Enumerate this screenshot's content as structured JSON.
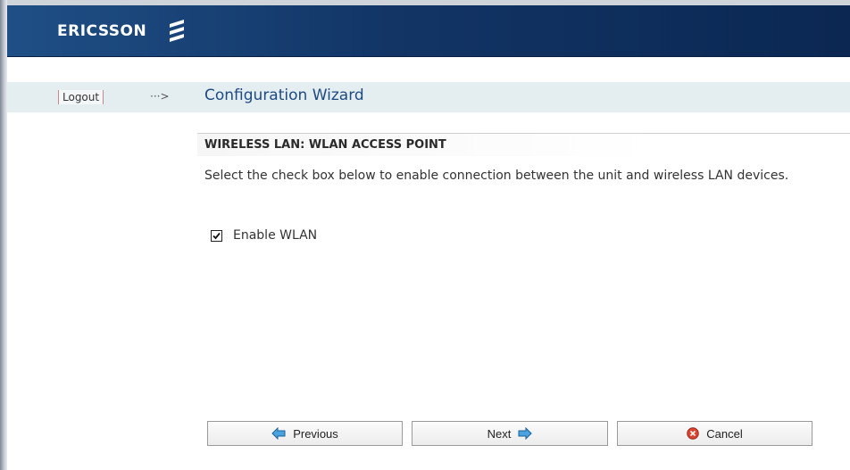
{
  "header": {
    "logo_text": "ERICSSON",
    "logo_icon": "ericsson-logo-icon",
    "background_color": "#123566"
  },
  "nav": {
    "logout_label": "Logout",
    "arrow_text": "···>",
    "title": "Configuration Wizard"
  },
  "section": {
    "title": "WIRELESS LAN: WLAN ACCESS POINT",
    "description": "Select the check box below to enable connection between the unit and wireless LAN devices."
  },
  "form": {
    "enable_wlan_label": "Enable WLAN",
    "enable_wlan_checked": true
  },
  "buttons": {
    "previous_label": "Previous",
    "next_label": "Next",
    "cancel_label": "Cancel",
    "previous_icon": "arrow-left-icon",
    "next_icon": "arrow-right-icon",
    "cancel_icon": "cancel-circle-icon"
  },
  "colors": {
    "accent": "#1e4a82",
    "nav_background": "#e4eef0",
    "arrow_icon_fill": "#4aa3df",
    "cancel_icon_fill": "#d9432f"
  }
}
